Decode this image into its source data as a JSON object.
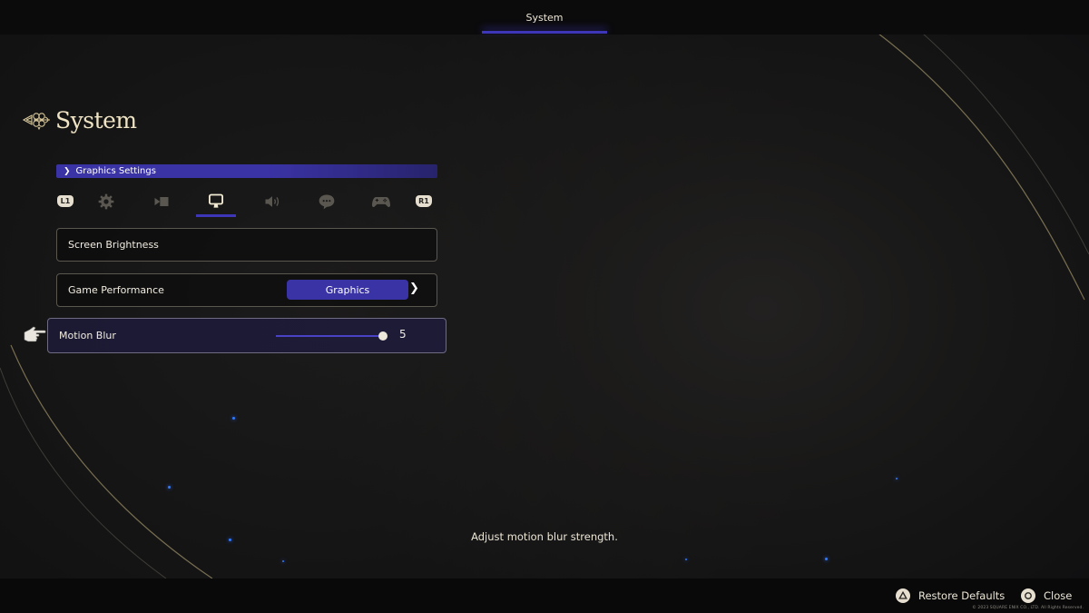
{
  "top_nav": {
    "tabs": [
      {
        "label": "System",
        "active": true
      }
    ]
  },
  "header": {
    "title": "System",
    "ornament_icon": "celtic-knot-ornament"
  },
  "breadcrumb": {
    "icon": "chevron-right",
    "label": "Graphics Settings"
  },
  "category_tabs": {
    "prev_button": "L1",
    "next_button": "R1",
    "items": [
      {
        "name": "general",
        "icon": "gear-icon",
        "active": false
      },
      {
        "name": "camera",
        "icon": "camera-icon",
        "active": false
      },
      {
        "name": "graphics",
        "icon": "monitor-icon",
        "active": true
      },
      {
        "name": "sound",
        "icon": "speaker-icon",
        "active": false
      },
      {
        "name": "subtitles",
        "icon": "speech-bubble-icon",
        "active": false
      },
      {
        "name": "controls",
        "icon": "gamepad-icon",
        "active": false
      }
    ]
  },
  "settings": [
    {
      "label": "Screen Brightness"
    },
    {
      "label": "Game Performance",
      "value": "Graphics",
      "arrow": "›"
    },
    {
      "label": "Motion Blur",
      "value": "5",
      "slider_fraction": 1.0,
      "selected": true
    }
  ],
  "help_text": "Adjust motion blur strength.",
  "footer": {
    "actions": [
      {
        "button": "triangle",
        "label": "Restore Defaults"
      },
      {
        "button": "circle",
        "label": "Close"
      }
    ],
    "copyright": "© 2023 SQUARE ENIX CO., LTD. All Rights Reserved."
  },
  "colors": {
    "accent": "#3a33a6",
    "slider_fill": "#4a42c6",
    "title_cream": "#efe4c4",
    "background": "#101011"
  }
}
